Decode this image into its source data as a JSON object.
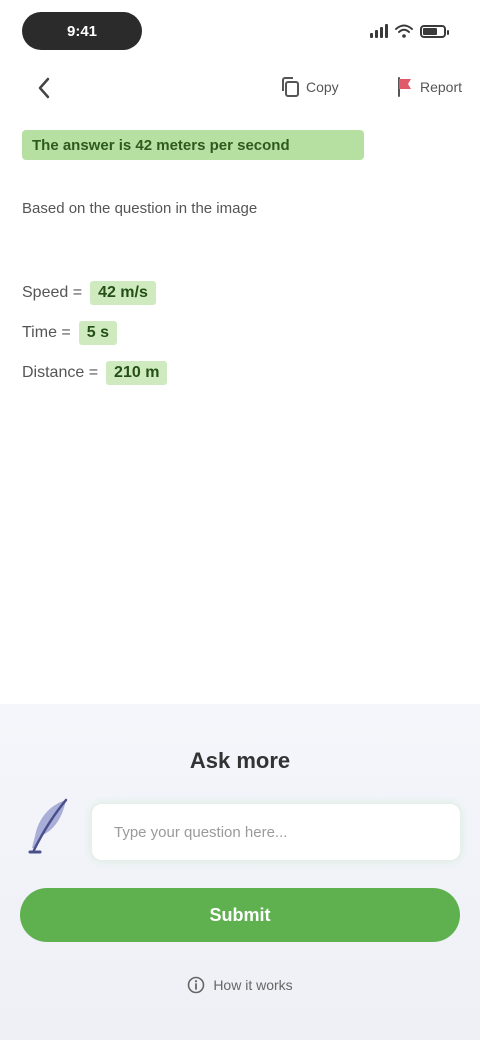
{
  "status_bar": {
    "time": "9:41",
    "icons": [
      "signal-icon",
      "wifi-icon",
      "battery-icon"
    ]
  },
  "nav": {
    "back_icon": "chevron-left-icon",
    "copy_label": "Copy",
    "flag_label": "Report"
  },
  "answer": {
    "highlight": "The answer is 42 meters per second",
    "source": "Based on the question in the image",
    "rows": [
      {
        "label": "Speed =",
        "value": "42 m/s"
      },
      {
        "label": "Time =",
        "value": "5 s"
      },
      {
        "label": "Distance =",
        "value": "210 m"
      }
    ]
  },
  "panel": {
    "title": "Ask more",
    "input_placeholder": "Type your question here...",
    "submit_label": "Submit",
    "footer_link": "How it works"
  },
  "colors": {
    "accent": "#5fb150",
    "highlight": "#b6e0a2",
    "chip": "#cfeabf"
  }
}
